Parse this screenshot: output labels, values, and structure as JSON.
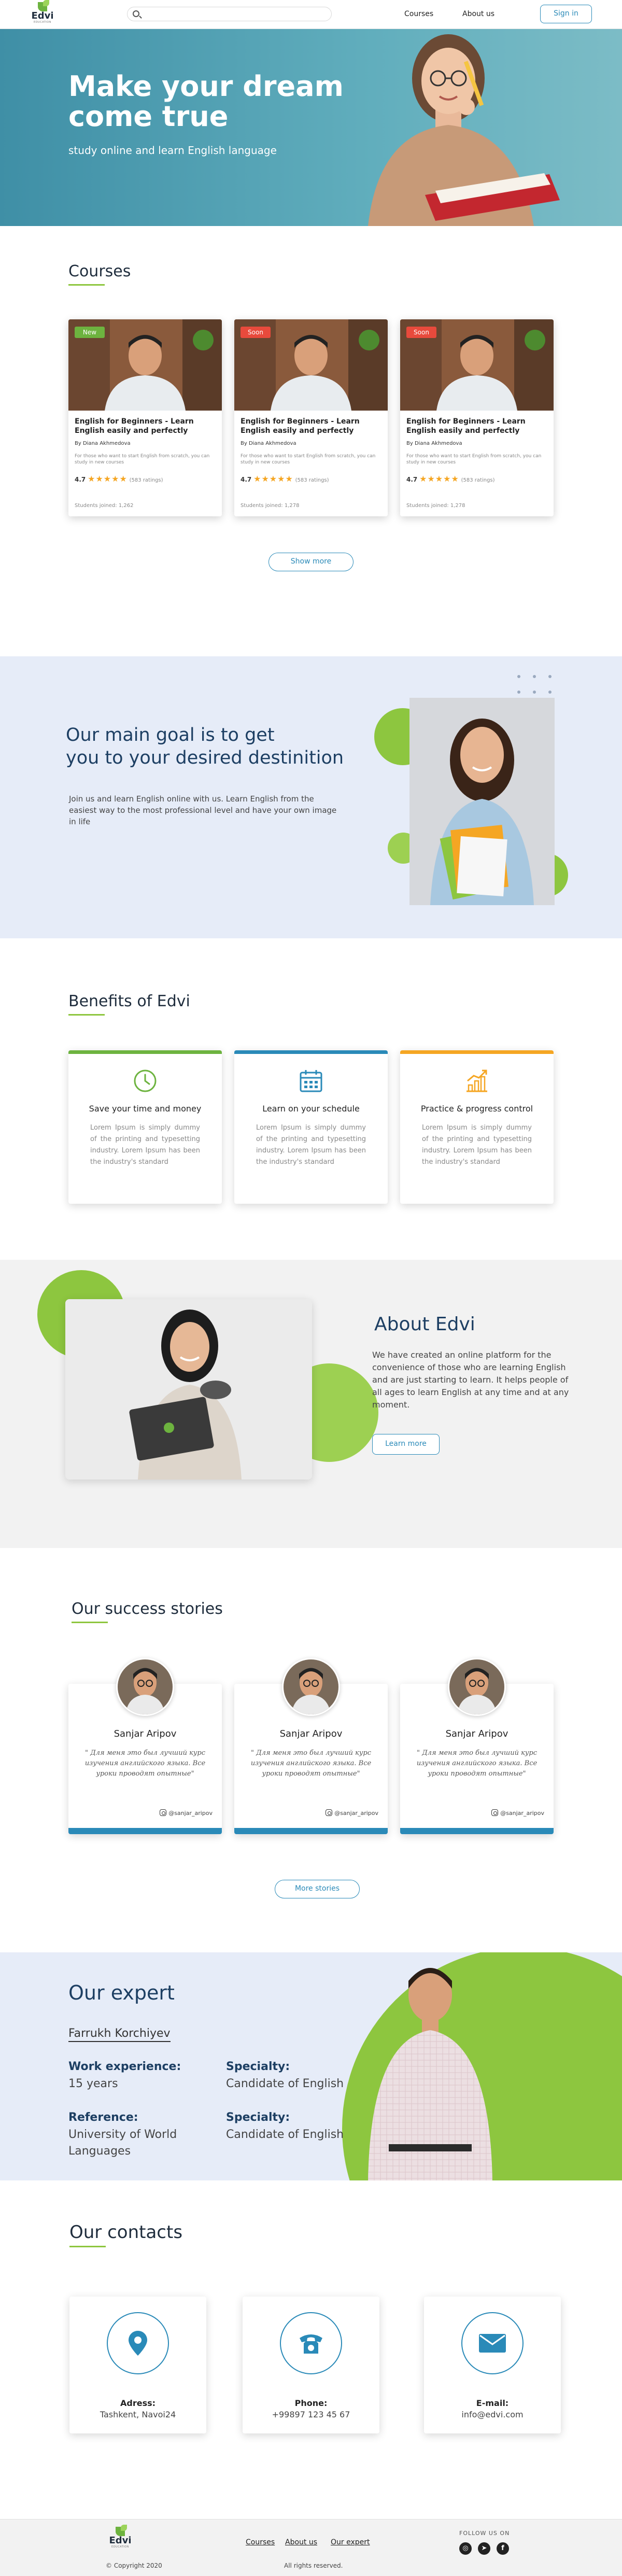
{
  "header": {
    "logo": "Edvi",
    "logo_sub": "EDUCATION",
    "search_placeholder": "",
    "nav": [
      "Courses",
      "About us"
    ],
    "signin": "Sign in"
  },
  "hero": {
    "title": "Make your dream come true",
    "subtitle": "study online and learn English language"
  },
  "courses": {
    "title": "Courses",
    "show_more": "Show more",
    "items": [
      {
        "badge": "New",
        "badge_color": "#6db33f",
        "title": "English for Beginners - Learn English easily and perfectly",
        "author": "By Diana Akhmedova",
        "description": "For those who want to start English from scratch, you can study in new courses",
        "rating": "4.7",
        "stars": "★★★★★",
        "ratings_count": "(583 ratings)",
        "students": "Students joined: 1,262"
      },
      {
        "badge": "Soon",
        "badge_color": "#e84a3c",
        "title": "English for Beginners - Learn English easily and perfectly",
        "author": "By Diana Akhmedova",
        "description": "For those who want to start English from scratch, you can study in new courses",
        "rating": "4.7",
        "stars": "★★★★★",
        "ratings_count": "(583 ratings)",
        "students": "Students joined: 1,278"
      },
      {
        "badge": "Soon",
        "badge_color": "#e84a3c",
        "title": "English for Beginners - Learn English easily and perfectly",
        "author": "By Diana Akhmedova",
        "description": "For those who want to start English from scratch, you can study in new courses",
        "rating": "4.7",
        "stars": "★★★★★",
        "ratings_count": "(583 ratings)",
        "students": "Students joined: 1,278"
      }
    ]
  },
  "goal": {
    "title_line1": "Our main goal is to get",
    "title_line2": "you to your desired destinition",
    "text": "Join us and learn English online with us. Learn English from the easiest  way to the most professional level and have your own image in life"
  },
  "benefits": {
    "title": "Benefits of Edvi",
    "items": [
      {
        "icon": "clock-icon",
        "color": "#6db33f",
        "title": "Save your time and money",
        "text": "Lorem Ipsum is simply dummy of the printing and typesetting industry. Lorem Ipsum has been the industry's standard"
      },
      {
        "icon": "calendar-icon",
        "color": "#2a8ab8",
        "title": "Learn on your schedule",
        "text": "Lorem Ipsum is simply dummy of the printing and typesetting industry. Lorem Ipsum has been the industry's standard"
      },
      {
        "icon": "chart-icon",
        "color": "#f5a623",
        "title": "Practice & progress control",
        "text": "Lorem Ipsum is simply dummy of the printing and typesetting industry. Lorem Ipsum has been the industry's standard"
      }
    ]
  },
  "about": {
    "title": "About Edvi",
    "text": "We have created an online platform for the convenience of those who are learning English and are just starting to learn. It helps people of all ages to learn English at any time and at any moment.",
    "button": "Learn more"
  },
  "stories": {
    "title": "Our success stories",
    "more": "More stories",
    "items": [
      {
        "name": "Sanjar Aripov",
        "quote": "\" Для меня это был лучший курс изучения английского языка. Все уроки проводят опытные\"",
        "instagram": "@sanjar_aripov"
      },
      {
        "name": "Sanjar Aripov",
        "quote": "\" Для меня это был лучший курс изучения английского языка. Все уроки проводят опытные\"",
        "instagram": "@sanjar_aripov"
      },
      {
        "name": "Sanjar Aripov",
        "quote": "\" Для меня это был лучший курс изучения английского языка. Все уроки проводят опытные\"",
        "instagram": "@sanjar_aripov"
      }
    ]
  },
  "expert": {
    "title": "Our expert",
    "name": "Farrukh Korchiyev",
    "work_label": "Work experience:",
    "work_value": "15 years",
    "specialty_label": "Specialty:",
    "specialty_value": "Candidate of English",
    "reference_label": "Reference:",
    "reference_value": "University of World Languages",
    "specialty2_label": "Specialty:",
    "specialty2_value": "Candidate of English"
  },
  "contacts": {
    "title": "Our contacts",
    "items": [
      {
        "icon": "location-pin-icon",
        "label": "Adress:",
        "value": "Tashkent, Navoi24"
      },
      {
        "icon": "phone-icon",
        "label": "Phone:",
        "value": "+99897 123  45 67"
      },
      {
        "icon": "envelope-icon",
        "label": "E-mail:",
        "value": "info@edvi.com"
      }
    ]
  },
  "footer": {
    "links": [
      "Courses",
      "About us",
      "Our expert"
    ],
    "follow": "FOLLOW US ON",
    "copyright": "© Copyright 2020",
    "rights": "All rights reserved."
  },
  "colors": {
    "accent_blue": "#2a8ab8",
    "accent_green": "#8dc63f",
    "hero_teal": "#4f9fb2",
    "dark_navy": "#1d3f63"
  }
}
